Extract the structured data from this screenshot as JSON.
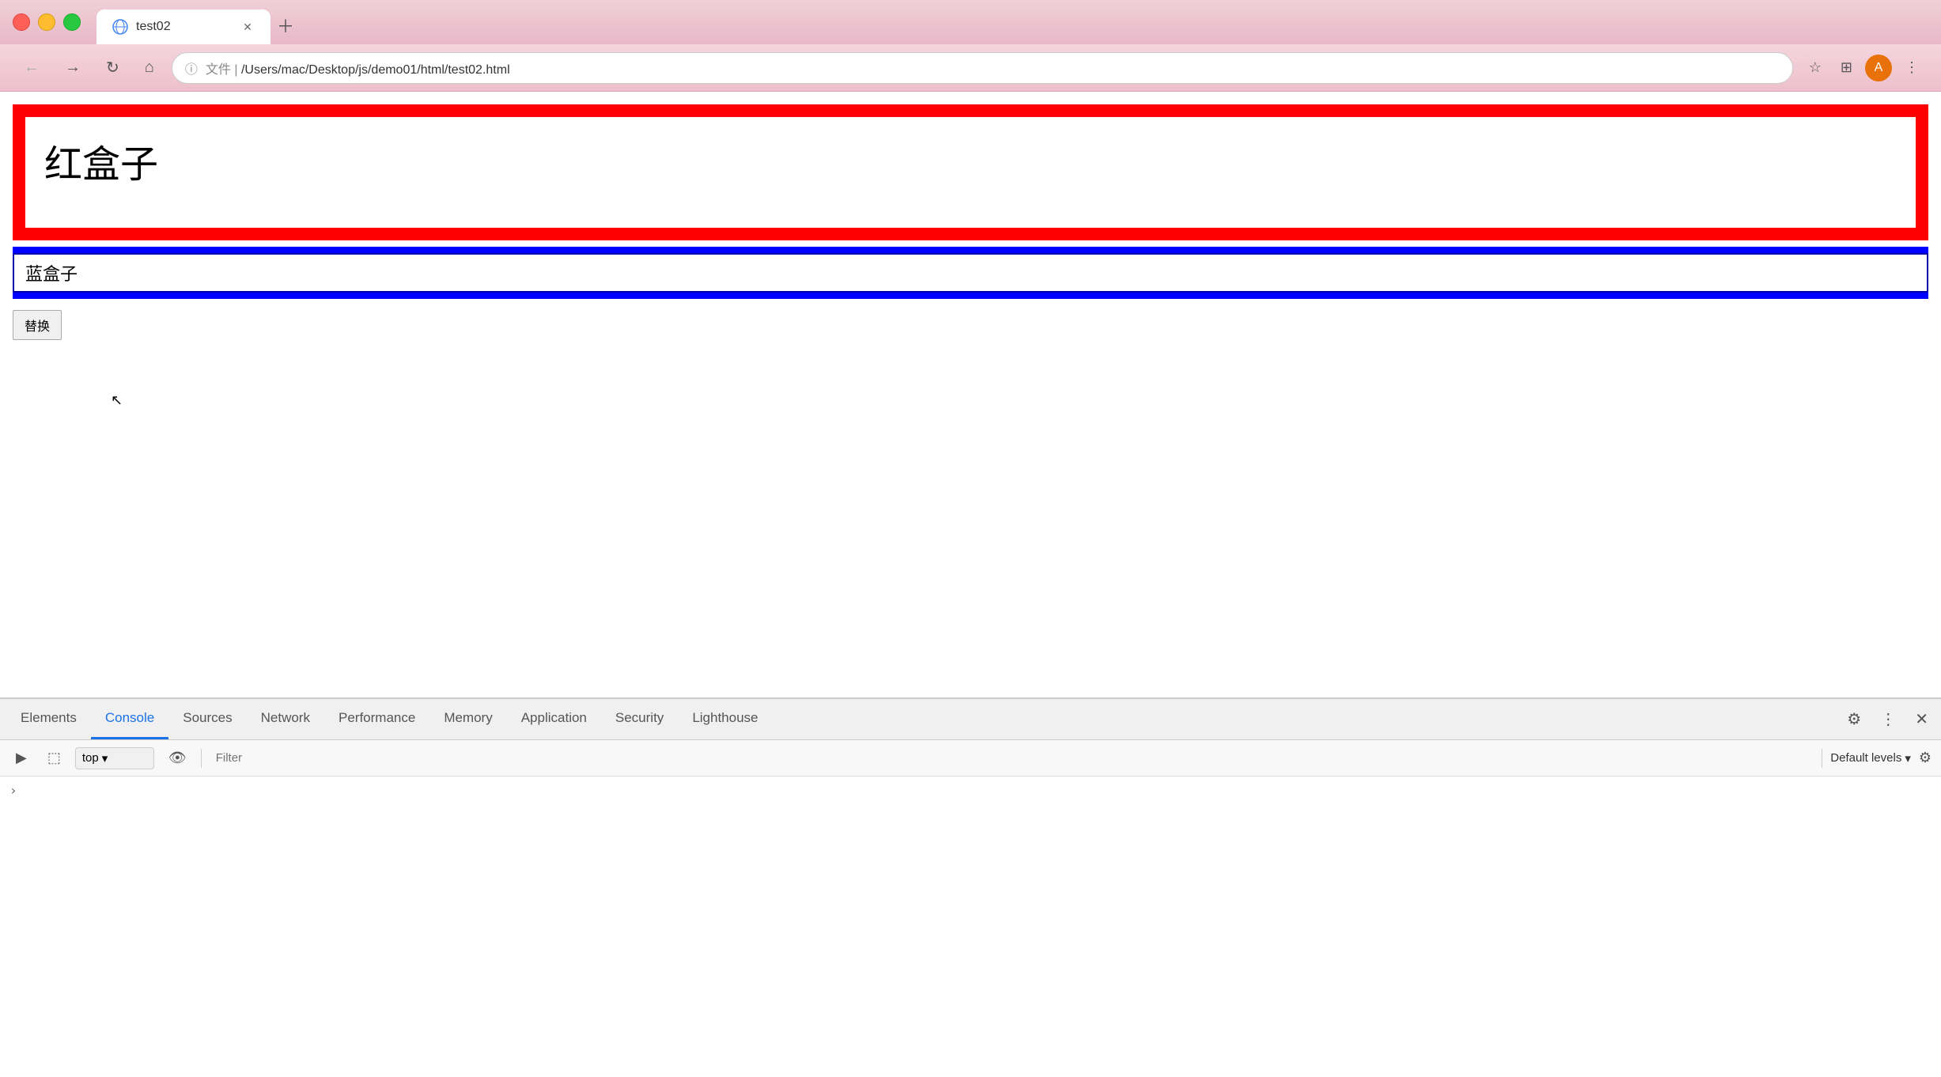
{
  "browser": {
    "tab": {
      "title": "test02",
      "favicon": "globe-icon"
    },
    "address": {
      "url": "/Users/mac/Desktop/js/demo01/html/test02.html",
      "protocol_icon": "info-icon"
    },
    "nav": {
      "back_label": "←",
      "forward_label": "→",
      "reload_label": "↻",
      "home_label": "⌂"
    }
  },
  "page": {
    "red_box_text": "红盒子",
    "blue_input_value": "蓝盒子",
    "replace_button_label": "替换"
  },
  "devtools": {
    "tabs": [
      {
        "id": "elements",
        "label": "Elements"
      },
      {
        "id": "console",
        "label": "Console"
      },
      {
        "id": "sources",
        "label": "Sources"
      },
      {
        "id": "network",
        "label": "Network"
      },
      {
        "id": "performance",
        "label": "Performance"
      },
      {
        "id": "memory",
        "label": "Memory"
      },
      {
        "id": "application",
        "label": "Application"
      },
      {
        "id": "security",
        "label": "Security"
      },
      {
        "id": "lighthouse",
        "label": "Lighthouse"
      }
    ],
    "active_tab": "console",
    "toolbar": {
      "context_label": "top",
      "filter_placeholder": "Filter",
      "levels_label": "Default levels"
    },
    "settings_icon": "gear-icon",
    "more_icon": "more-icon",
    "close_icon": "close-icon"
  }
}
